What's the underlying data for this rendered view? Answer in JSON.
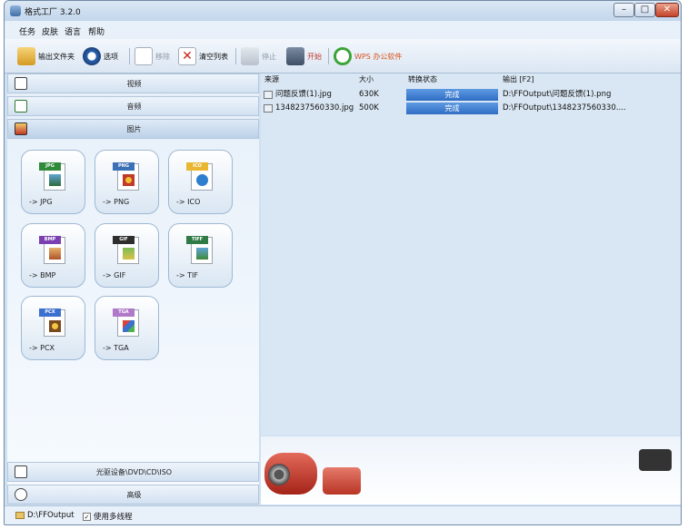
{
  "window": {
    "title": "格式工厂 3.2.0"
  },
  "menu": [
    "任务",
    "皮肤",
    "语言",
    "帮助"
  ],
  "toolbar": {
    "output_folder": "输出文件夹",
    "options": "选项",
    "remove": "移除",
    "clear_list": "清空列表",
    "stop": "停止",
    "start": "开始",
    "wps": "WPS 办公软件"
  },
  "categories": {
    "video": "视频",
    "audio": "音频",
    "picture": "图片",
    "optical": "光驱设备\\DVD\\CD\\ISO",
    "advanced": "高级"
  },
  "tiles": [
    {
      "badge": "JPG",
      "label": "-> JPG",
      "color": "#2f8a3a"
    },
    {
      "badge": "PNG",
      "label": "-> PNG",
      "color": "#3b6fb6"
    },
    {
      "badge": "ICO",
      "label": "-> ICO",
      "color": "#e8b630"
    },
    {
      "badge": "BMP",
      "label": "-> BMP",
      "color": "#7a3fb0"
    },
    {
      "badge": "GIF",
      "label": "-> GIF",
      "color": "#2e2e2e"
    },
    {
      "badge": "TIFF",
      "label": "-> TIF",
      "color": "#2f7a45"
    },
    {
      "badge": "PCX",
      "label": "-> PCX",
      "color": "#3b6fd0"
    },
    {
      "badge": "TGA",
      "label": "-> TGA",
      "color": "#b07ac8"
    }
  ],
  "task_table": {
    "headers": [
      "来源",
      "大小",
      "转换状态",
      "输出 [F2]"
    ],
    "rows": [
      {
        "source": "问题反馈(1).jpg",
        "size": "630K",
        "status": "完成",
        "output": "D:\\FFOutput\\问题反馈(1).png"
      },
      {
        "source": "1348237560330.jpg",
        "size": "500K",
        "status": "完成",
        "output": "D:\\FFOutput\\1348237560330...."
      }
    ]
  },
  "statusbar": {
    "output_path": "D:\\FFOutput",
    "multithread_label": "使用多线程",
    "multithread_checked": true
  },
  "colors": {
    "accent": "#2f6dc4",
    "pane": "#d9e6f3"
  }
}
